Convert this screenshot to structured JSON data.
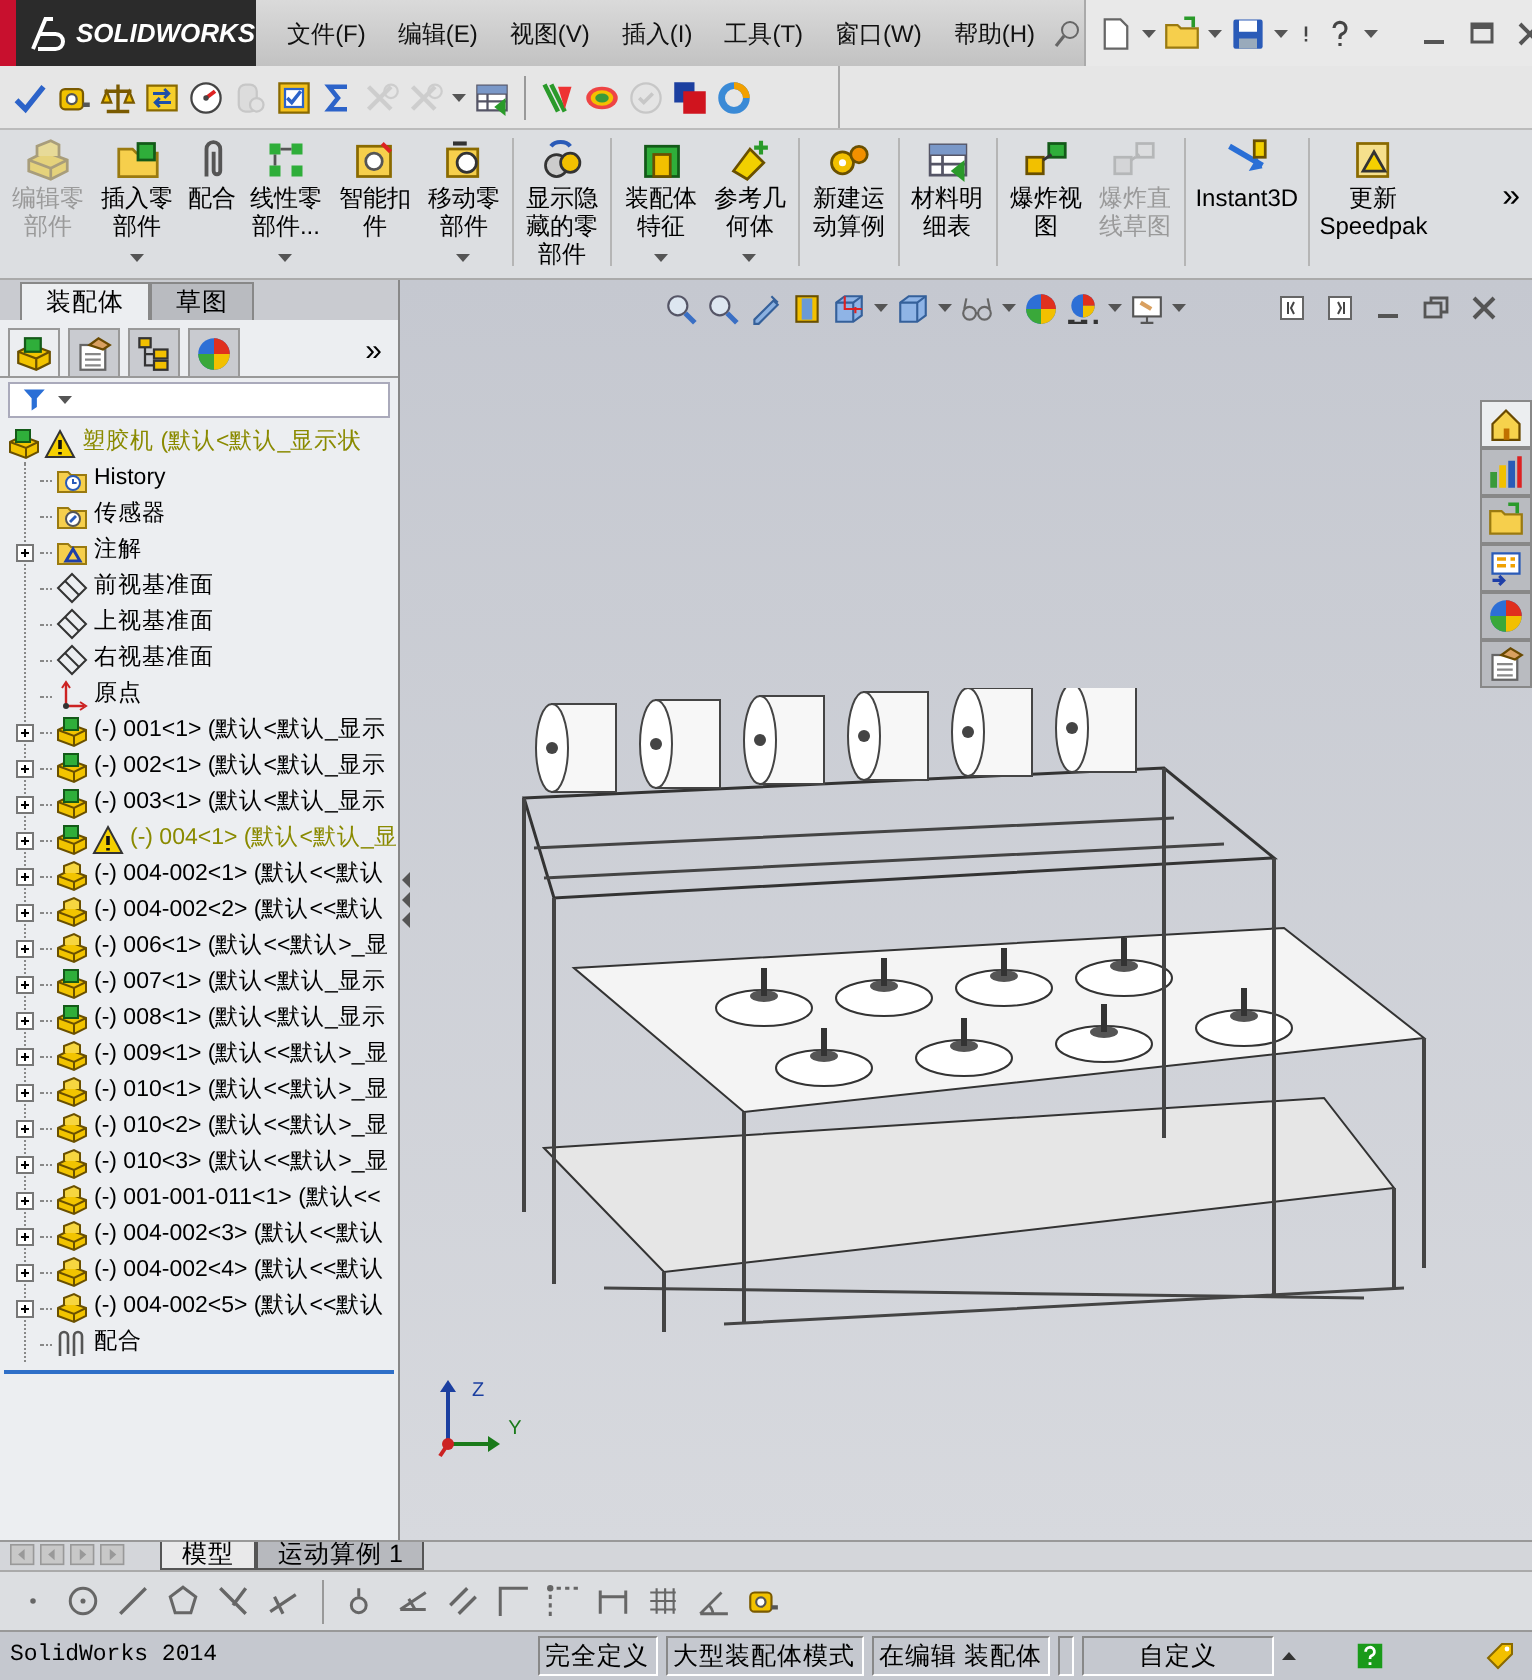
{
  "logo": {
    "text": "SOLIDWORKS"
  },
  "menu": [
    {
      "label": "文件(F)"
    },
    {
      "label": "编辑(E)"
    },
    {
      "label": "视图(V)"
    },
    {
      "label": "插入(I)"
    },
    {
      "label": "工具(T)"
    },
    {
      "label": "窗口(W)"
    },
    {
      "label": "帮助(H)"
    }
  ],
  "toolbar": [
    {
      "disabled": false
    },
    {
      "disabled": false
    },
    {
      "disabled": false
    },
    {
      "disabled": false
    },
    {
      "disabled": false
    },
    {
      "disabled": true
    },
    {
      "disabled": false
    },
    {
      "disabled": false
    },
    {
      "disabled": true
    },
    {
      "disabled": true
    },
    {
      "disabled": false
    },
    {
      "disabled": false
    },
    {
      "disabled": false
    },
    {
      "disabled": true
    },
    {
      "disabled": false
    },
    {
      "disabled": false
    }
  ],
  "command_buttons": [
    {
      "label": "编辑零部件",
      "disabled": true,
      "dropdown": false
    },
    {
      "label": "插入零部件",
      "disabled": false,
      "dropdown": true
    },
    {
      "label": "配合",
      "disabled": false,
      "dropdown": false
    },
    {
      "label": "线性零部件...",
      "disabled": false,
      "dropdown": true
    },
    {
      "label": "智能扣件",
      "disabled": false,
      "dropdown": false
    },
    {
      "label": "移动零部件",
      "disabled": false,
      "dropdown": true
    },
    {
      "label": "显示隐藏的零部件",
      "disabled": false,
      "dropdown": false
    },
    {
      "label": "装配体特征",
      "disabled": false,
      "dropdown": true
    },
    {
      "label": "参考几何体",
      "disabled": false,
      "dropdown": true
    },
    {
      "label": "新建运动算例",
      "disabled": false,
      "dropdown": false
    },
    {
      "label": "材料明细表",
      "disabled": false,
      "dropdown": false
    },
    {
      "label": "爆炸视图",
      "disabled": false,
      "dropdown": false
    },
    {
      "label": "爆炸直线草图",
      "disabled": true,
      "dropdown": false
    },
    {
      "label": "Instant3D",
      "disabled": false,
      "dropdown": false
    },
    {
      "label": "更新Speedpak",
      "disabled": false,
      "dropdown": false
    }
  ],
  "command_more": "»",
  "panel_tabs": [
    {
      "label": "装配体",
      "selected": true
    },
    {
      "label": "草图",
      "selected": false
    }
  ],
  "manager_tabs": [
    {
      "selected": true
    },
    {
      "selected": false
    },
    {
      "selected": false
    },
    {
      "selected": false
    }
  ],
  "manager_more": "»",
  "tree": {
    "label": "塑胶机 (默认<默认_显示状",
    "warning": true,
    "expanded": true,
    "children": [
      {
        "kind": "history",
        "label": "History",
        "warning": false,
        "collapsed": false
      },
      {
        "kind": "sensors",
        "label": "传感器",
        "warning": false,
        "collapsed": false
      },
      {
        "kind": "annotations",
        "label": "注解",
        "warning": false,
        "collapsed": true
      },
      {
        "kind": "plane",
        "label": "前视基准面",
        "warning": false,
        "collapsed": false
      },
      {
        "kind": "plane",
        "label": "上视基准面",
        "warning": false,
        "collapsed": false
      },
      {
        "kind": "plane",
        "label": "右视基准面",
        "warning": false,
        "collapsed": false
      },
      {
        "kind": "origin",
        "label": "原点",
        "warning": false,
        "collapsed": false
      },
      {
        "kind": "assembly",
        "label": "(-) 001<1> (默认<默认_显示",
        "warning": false,
        "collapsed": true
      },
      {
        "kind": "assembly",
        "label": "(-) 002<1> (默认<默认_显示",
        "warning": false,
        "collapsed": true
      },
      {
        "kind": "assembly",
        "label": "(-) 003<1> (默认<默认_显示",
        "warning": false,
        "collapsed": true
      },
      {
        "kind": "assembly",
        "label": "(-) 004<1> (默认<默认_显",
        "warning": true,
        "collapsed": true
      },
      {
        "kind": "part",
        "label": "(-) 004-002<1> (默认<<默认",
        "warning": false,
        "collapsed": true
      },
      {
        "kind": "part",
        "label": "(-) 004-002<2> (默认<<默认",
        "warning": false,
        "collapsed": true
      },
      {
        "kind": "part",
        "label": "(-) 006<1> (默认<<默认>_显",
        "warning": false,
        "collapsed": true
      },
      {
        "kind": "assembly",
        "label": "(-) 007<1> (默认<默认_显示",
        "warning": false,
        "collapsed": true
      },
      {
        "kind": "assembly",
        "label": "(-) 008<1> (默认<默认_显示",
        "warning": false,
        "collapsed": true
      },
      {
        "kind": "part",
        "label": "(-) 009<1> (默认<<默认>_显",
        "warning": false,
        "collapsed": true
      },
      {
        "kind": "part",
        "label": "(-) 010<1> (默认<<默认>_显",
        "warning": false,
        "collapsed": true
      },
      {
        "kind": "part",
        "label": "(-) 010<2> (默认<<默认>_显",
        "warning": false,
        "collapsed": true
      },
      {
        "kind": "part",
        "label": "(-) 010<3> (默认<<默认>_显",
        "warning": false,
        "collapsed": true
      },
      {
        "kind": "part",
        "label": "(-) 001-001-011<1> (默认<<",
        "warning": false,
        "collapsed": true
      },
      {
        "kind": "part",
        "label": "(-) 004-002<3> (默认<<默认",
        "warning": false,
        "collapsed": true
      },
      {
        "kind": "part",
        "label": "(-) 004-002<4> (默认<<默认",
        "warning": false,
        "collapsed": true
      },
      {
        "kind": "part",
        "label": "(-) 004-002<5> (默认<<默认",
        "warning": false,
        "collapsed": true
      },
      {
        "kind": "mates",
        "label": "配合",
        "warning": false,
        "collapsed": false
      }
    ]
  },
  "task_pane": [
    {
      "selected": true
    },
    {
      "selected": false
    },
    {
      "selected": false
    },
    {
      "selected": false
    },
    {
      "selected": false
    },
    {
      "selected": false
    }
  ],
  "triad": {
    "z": "Z",
    "y": "Y"
  },
  "bottom_tabs": [
    {
      "label": "模型",
      "selected": true
    },
    {
      "label": "运动算例 1",
      "selected": false
    }
  ],
  "status_bar": {
    "app": "SolidWorks 2014",
    "fields": [
      "完全定义",
      "大型装配体模式",
      "在编辑 装配体"
    ],
    "units": "自定义"
  }
}
